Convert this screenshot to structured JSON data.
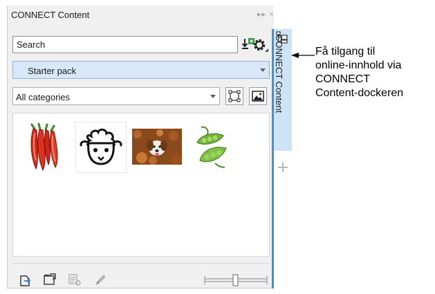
{
  "docker": {
    "title": "CONNECT Content",
    "title_buttons": "▸▸ ×",
    "search": {
      "placeholder": "Search"
    },
    "pack_select": {
      "value": "Starter pack"
    },
    "category_select": {
      "value": "All categories"
    },
    "gallery": {
      "items": [
        {
          "icon": "chili-peppers-thumbnail"
        },
        {
          "icon": "sheep-face-thumbnail"
        },
        {
          "icon": "dog-in-leaves-thumbnail"
        },
        {
          "icon": "green-peas-thumbnail"
        }
      ]
    },
    "tab_label": "CONNECT Content",
    "slider": {
      "value": 0.5
    }
  },
  "callout": {
    "lines": [
      "Få tilgang til",
      "online-innhold via",
      "CONNECT",
      "Content-dockeren"
    ]
  },
  "colors": {
    "accent": "#3a93e0",
    "selected_bg": "#d8e8f8",
    "tab_bg": "#cfe3f6"
  }
}
